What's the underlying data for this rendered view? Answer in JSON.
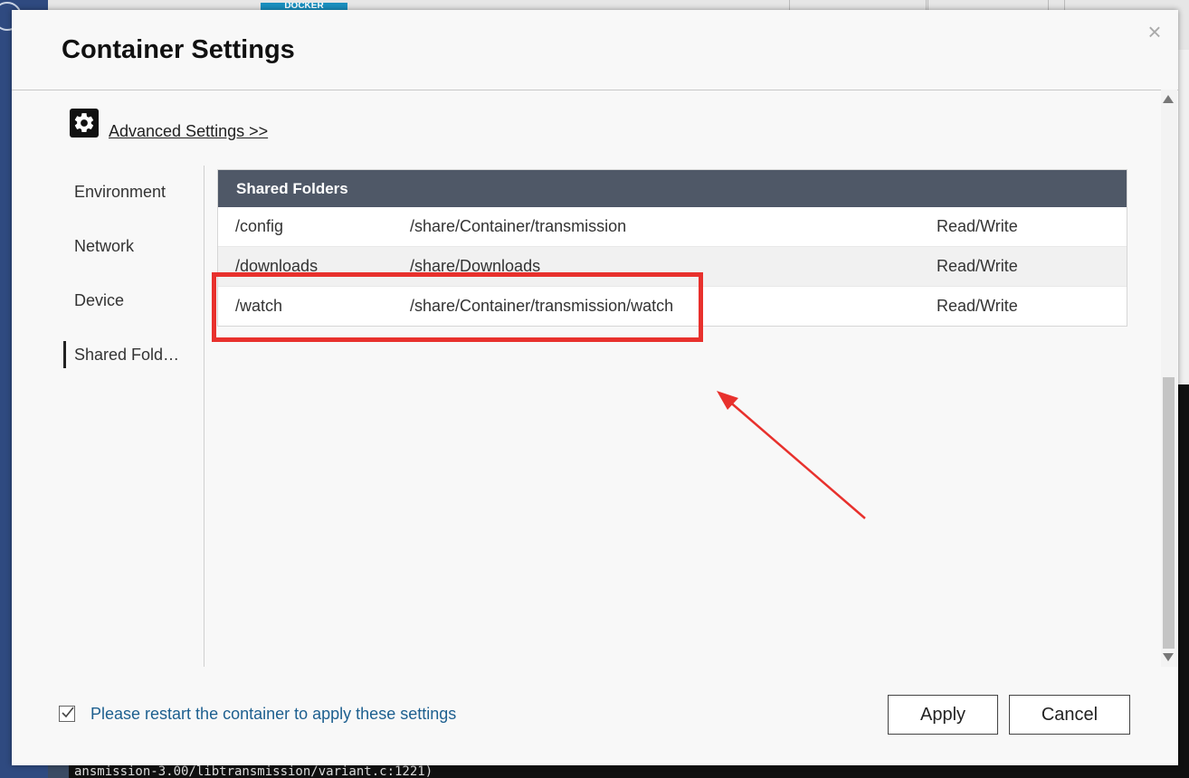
{
  "background": {
    "badge_label": "DOCKER",
    "terminal_line": "ansmission-3.00/libtransmission/variant.c:1221)"
  },
  "modal": {
    "title": "Container Settings",
    "close_label": "×",
    "advanced_link": "Advanced Settings >>",
    "sidebar": {
      "items": [
        {
          "label": "Environment",
          "active": false
        },
        {
          "label": "Network",
          "active": false
        },
        {
          "label": "Device",
          "active": false
        },
        {
          "label": "Shared Fold…",
          "active": true
        }
      ]
    },
    "shared_folders": {
      "header": "Shared Folders",
      "rows": [
        {
          "container_path": "/config",
          "host_path": "/share/Container/transmission",
          "permission": "Read/Write"
        },
        {
          "container_path": "/downloads",
          "host_path": "/share/Downloads",
          "permission": "Read/Write"
        },
        {
          "container_path": "/watch",
          "host_path": "/share/Container/transmission/watch",
          "permission": "Read/Write"
        }
      ]
    },
    "footer": {
      "restart_checked": true,
      "restart_note": "Please restart the container to apply these settings",
      "apply_label": "Apply",
      "cancel_label": "Cancel"
    }
  },
  "colors": {
    "table_header_bg": "#4f5867",
    "note_text": "#1d5f8f",
    "annotation_red": "#e8312d"
  }
}
